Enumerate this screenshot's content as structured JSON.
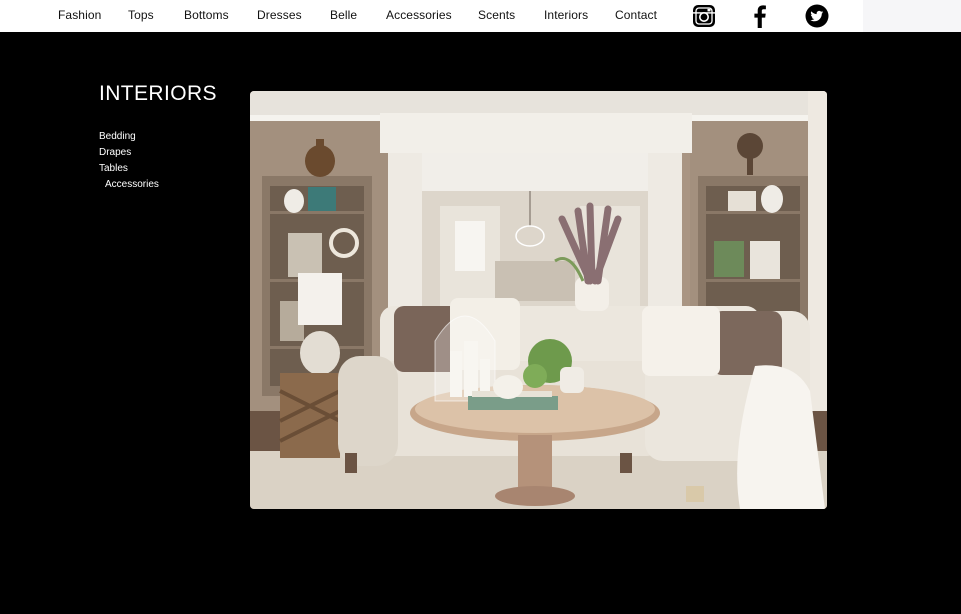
{
  "nav": {
    "items": [
      "Fashion",
      "Tops",
      "Bottoms",
      "Dresses",
      "Belle",
      "Accessories",
      "Scents",
      "Interiors",
      "Contact"
    ]
  },
  "social": {
    "instagram_icon": "instagram-icon",
    "facebook_icon": "facebook-icon",
    "twitter_icon": "twitter-icon"
  },
  "page": {
    "title": "INTERIORS"
  },
  "sidebar": {
    "links": [
      "Bedding",
      "Drapes",
      "Tables",
      "Accessories"
    ]
  },
  "colors": {
    "background": "#000000",
    "topbar": "#ffffff",
    "text_on_dark": "#ffffff",
    "text_on_light": "#111111"
  }
}
